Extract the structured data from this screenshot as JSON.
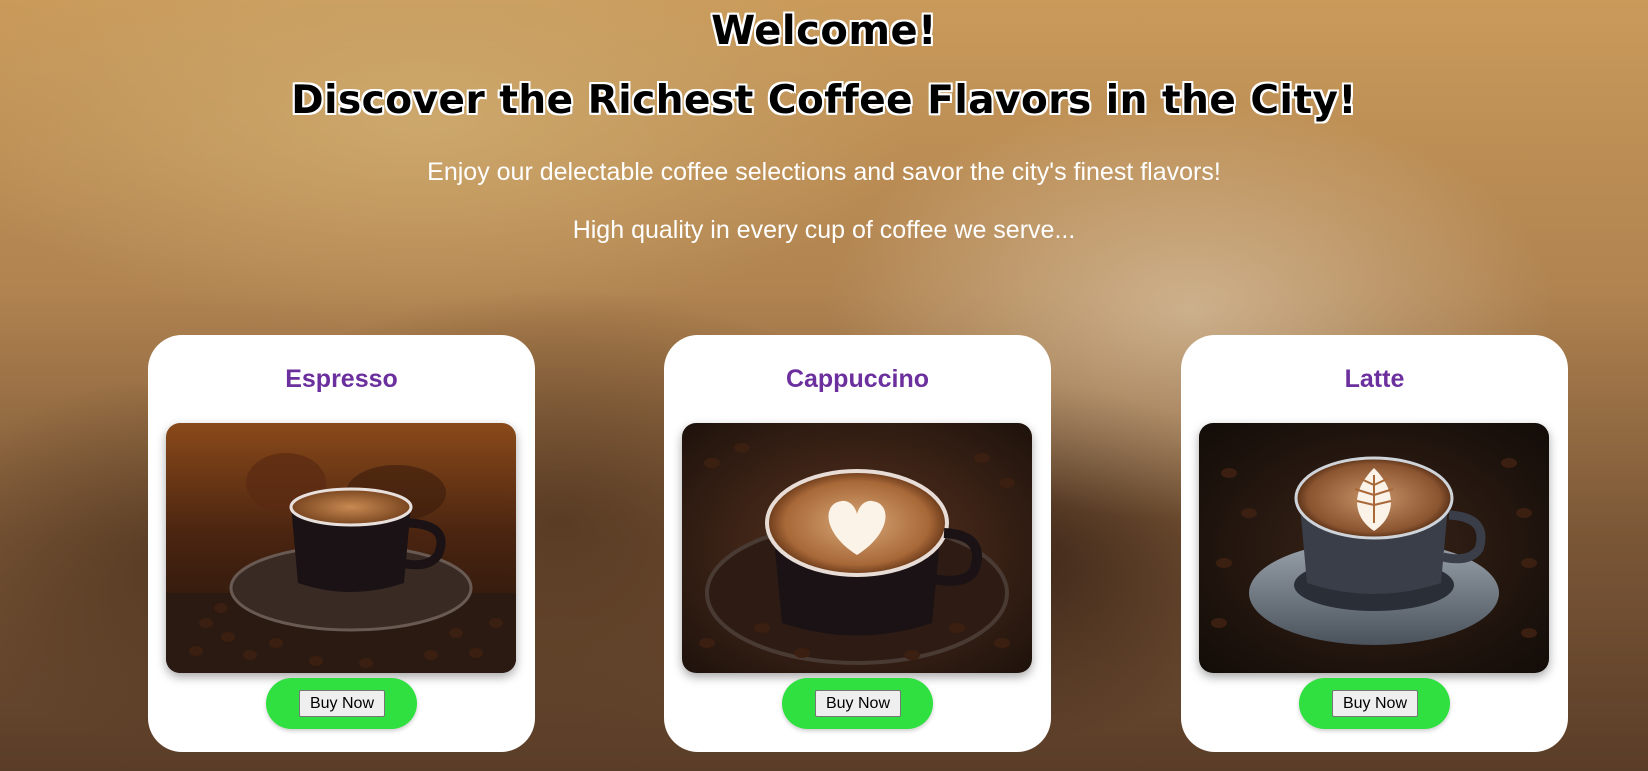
{
  "hero": {
    "welcome": "Welcome!",
    "headline": "Discover the Richest Coffee Flavors in the City!",
    "tagline_1": "Enjoy our delectable coffee selections and savor the city's finest flavors!",
    "tagline_2": "High quality in every cup of coffee we serve..."
  },
  "products": [
    {
      "name": "Espresso",
      "button_label": "Buy Now",
      "image": "espresso-cup-photo"
    },
    {
      "name": "Cappuccino",
      "button_label": "Buy Now",
      "image": "cappuccino-heart-latte-art-photo"
    },
    {
      "name": "Latte",
      "button_label": "Buy Now",
      "image": "latte-leaf-art-photo"
    }
  ],
  "colors": {
    "product_title": "#6b2f9e",
    "buy_pill": "#2fe040",
    "card_background": "#ffffff"
  }
}
